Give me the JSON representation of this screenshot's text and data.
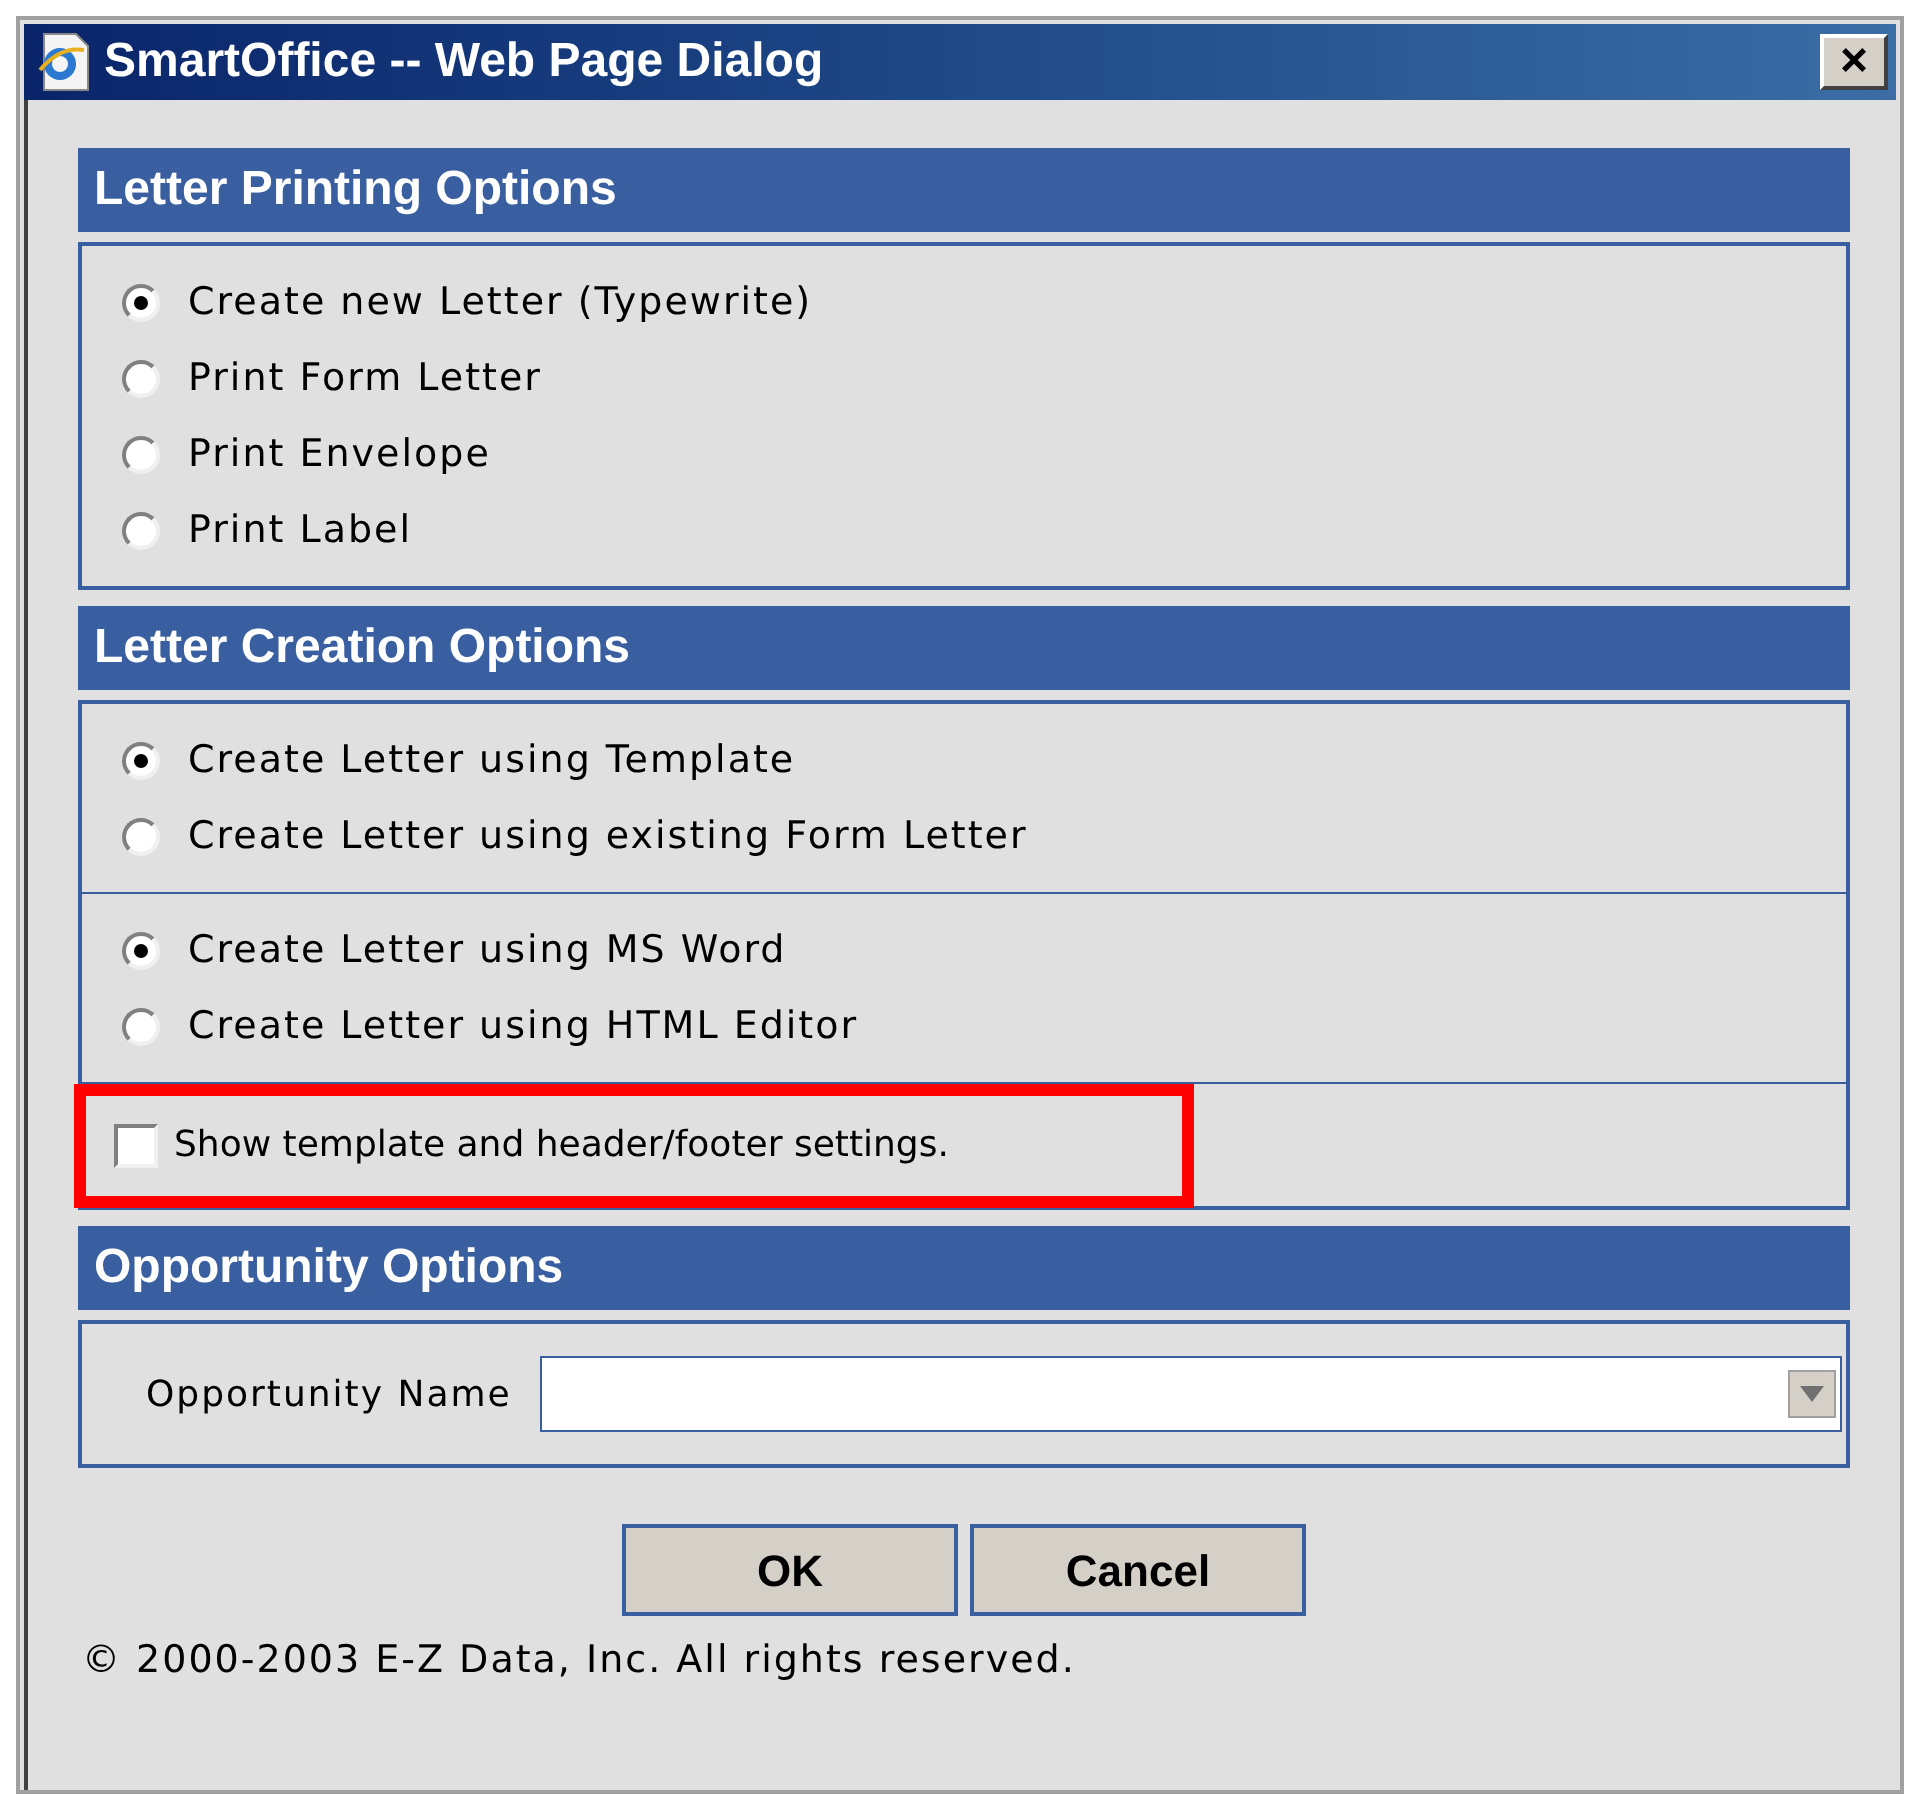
{
  "window": {
    "title": "SmartOffice -- Web Page Dialog",
    "close": "×"
  },
  "sections": [
    {
      "title": "Letter Printing Options",
      "parts": [
        {
          "kind": "radio_group",
          "options": [
            {
              "label": "Create new Letter (Typewrite)",
              "selected": true
            },
            {
              "label": "Print Form Letter",
              "selected": false
            },
            {
              "label": "Print Envelope",
              "selected": false
            },
            {
              "label": "Print Label",
              "selected": false
            }
          ]
        }
      ]
    },
    {
      "title": "Letter Creation Options",
      "parts": [
        {
          "kind": "radio_group",
          "options": [
            {
              "label": "Create Letter using Template",
              "selected": true
            },
            {
              "label": "Create Letter using existing Form Letter",
              "selected": false
            }
          ]
        },
        {
          "kind": "radio_group",
          "options": [
            {
              "label": "Create Letter using MS Word",
              "selected": true
            },
            {
              "label": "Create Letter using HTML Editor",
              "selected": false
            }
          ]
        },
        {
          "kind": "checkbox",
          "label": "Show template and header/footer settings.",
          "checked": false,
          "highlighted": true
        }
      ]
    },
    {
      "title": "Opportunity Options",
      "parts": [
        {
          "kind": "select",
          "label": "Opportunity Name"
        }
      ]
    }
  ],
  "buttons": [
    "OK",
    "Cancel"
  ],
  "copyright": "© 2000-2003 E-Z Data, Inc. All rights reserved."
}
